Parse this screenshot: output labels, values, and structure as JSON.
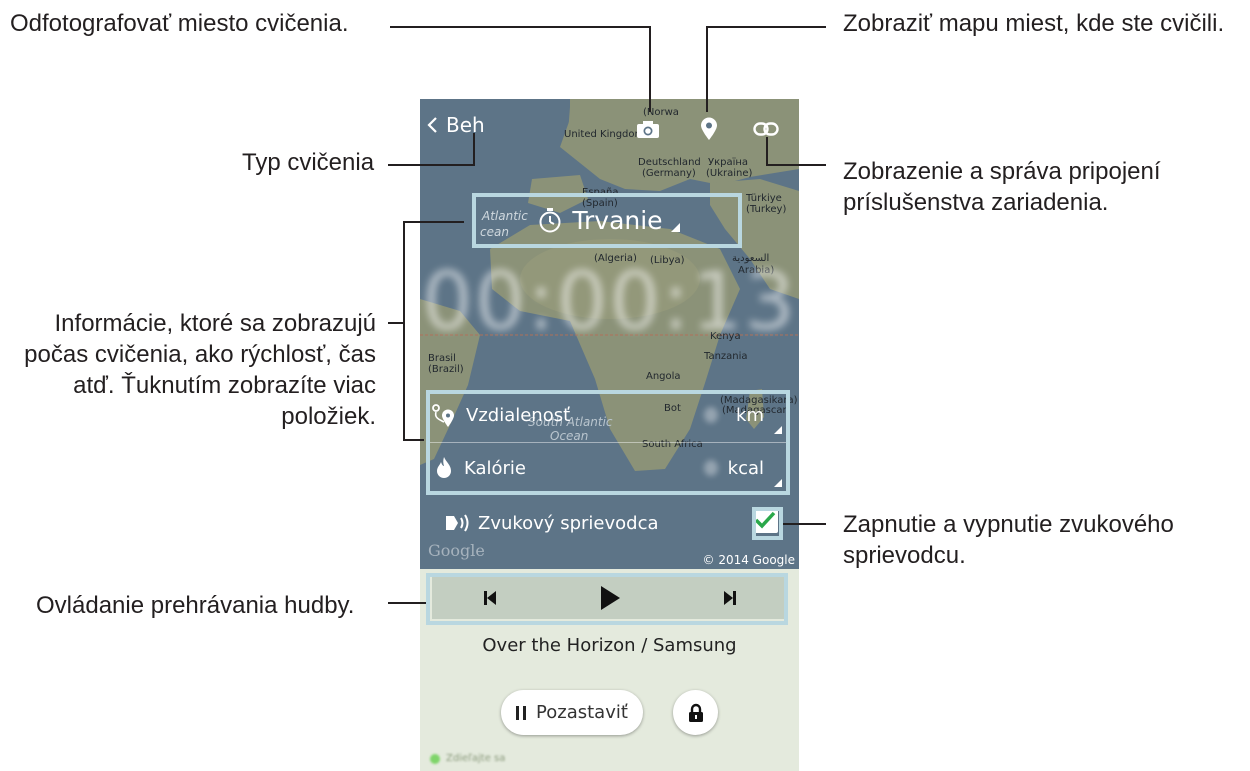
{
  "callouts": {
    "photo": "Odfotografovať miesto cvičenia.",
    "map": "Zobraziť mapu miest, kde ste cvičili.",
    "type": "Typ cvičenia",
    "accessory_1": "Zobrazenie a správa pripojení",
    "accessory_2": "príslušenstva zariadenia.",
    "info_1": "Informácie, ktoré sa zobrazujú",
    "info_2": "počas cvičenia, ako rýchlosť, čas",
    "info_3": "atď. Ťuknutím zobrazíte viac",
    "info_4": "položiek.",
    "audio_1": "Zapnutie a vypnutie zvukového",
    "audio_2": "sprievodcu.",
    "music": "Ovládanie prehrávania hudby."
  },
  "map_labels": {
    "norway": "(Norwa",
    "uk": "United Kingdom",
    "germany_1": "Deutschland",
    "germany_2": "(Germany)",
    "ukraine_1": "Україна",
    "ukraine_2": "(Ukraine)",
    "spain_1": "España",
    "spain_2": "(Spain)",
    "turkey_1": "Türkiye",
    "turkey_2": "(Turkey)",
    "atlantic_1": "Atlantic",
    "atlantic_2": "cean",
    "algeria": "(Algeria)",
    "libya": "(Libya)",
    "saudi_1": "السعودية",
    "saudi_2": "Arabia)",
    "kenya": "Kenya",
    "tanzania": "Tanzania",
    "brasil_1": "Brasil",
    "brasil_2": "(Brazil)",
    "angola": "Angola",
    "botswana": "Bot",
    "madagascar_1": "(Madagasikara)",
    "madagascar_2": "(Madagascar)",
    "south_atlantic_1": "South Atlantic",
    "south_atlantic_2": "Ocean",
    "south_africa": "South Africa"
  },
  "screen": {
    "back_label": "Beh",
    "duration_label": "Trvanie",
    "timer": "00:00:13",
    "rows": [
      {
        "label": "Vzdialenosť",
        "unit": "km"
      },
      {
        "label": "Kalórie",
        "unit": "kcal"
      }
    ],
    "audio_guide_label": "Zvukový sprievodca",
    "audio_guide_checked": true,
    "google_logo": "Google",
    "copyright": "© 2014 Google",
    "song": "Over the Horizon / Samsung",
    "pause_label": "Pozastaviť",
    "status": "Zdieľajte sa"
  },
  "icons": {
    "back": "chevron-left-icon",
    "camera": "camera-icon",
    "map_pin": "map-pin-icon",
    "accessory": "link-icon",
    "timer": "stopwatch-icon",
    "distance": "route-pin-icon",
    "calories": "flame-icon",
    "audio": "speaker-guide-icon",
    "prev": "skip-previous-icon",
    "play": "play-icon",
    "next": "skip-next-icon",
    "pause": "pause-icon",
    "lock": "lock-icon"
  },
  "colors": {
    "map_sea": "#5d7487",
    "map_land": "#8b9278",
    "accent_check": "#2aa84a",
    "bottom_panel": "#e4eadd",
    "music_bar": "#c3cec1",
    "callout_line": "#231f20",
    "highlight_box": "#b9d7e0"
  }
}
